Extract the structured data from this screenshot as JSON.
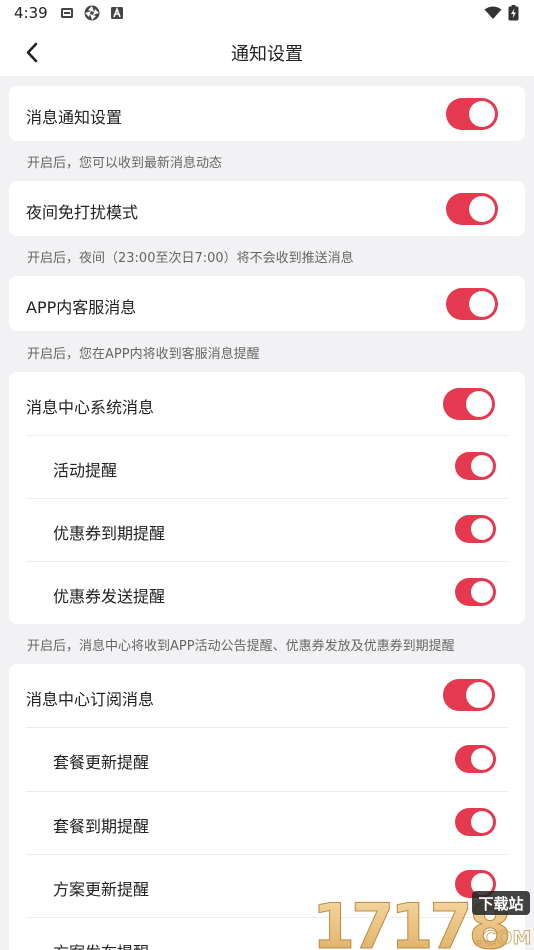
{
  "status_bar": {
    "time": "4:39"
  },
  "header": {
    "title": "通知设置"
  },
  "sections": [
    {
      "label": "消息通知设置",
      "enabled": true,
      "desc": "开启后，您可以收到最新消息动态"
    },
    {
      "label": "夜间免打扰模式",
      "enabled": true,
      "desc": "开启后，夜间（23:00至次日7:00）将不会收到推送消息"
    },
    {
      "label": "APP内客服消息",
      "enabled": true,
      "desc": "开启后，您在APP内将收到客服消息提醒"
    },
    {
      "label": "消息中心系统消息",
      "enabled": true,
      "items": [
        {
          "label": "活动提醒",
          "enabled": true
        },
        {
          "label": "优惠券到期提醒",
          "enabled": true
        },
        {
          "label": "优惠券发送提醒",
          "enabled": true
        }
      ],
      "desc": "开启后，消息中心将收到APP活动公告提醒、优惠券发放及优惠券到期提醒"
    },
    {
      "label": "消息中心订阅消息",
      "enabled": true,
      "items": [
        {
          "label": "套餐更新提醒",
          "enabled": true
        },
        {
          "label": "套餐到期提醒",
          "enabled": true
        },
        {
          "label": "方案更新提醒",
          "enabled": true
        },
        {
          "label": "方案发布提醒",
          "enabled": true
        }
      ]
    }
  ],
  "watermark": {
    "text": "17178",
    "badge": "下载站",
    "suffix": ".COM"
  },
  "colors": {
    "accent": "#e5394f",
    "background": "#f2f2f4"
  }
}
